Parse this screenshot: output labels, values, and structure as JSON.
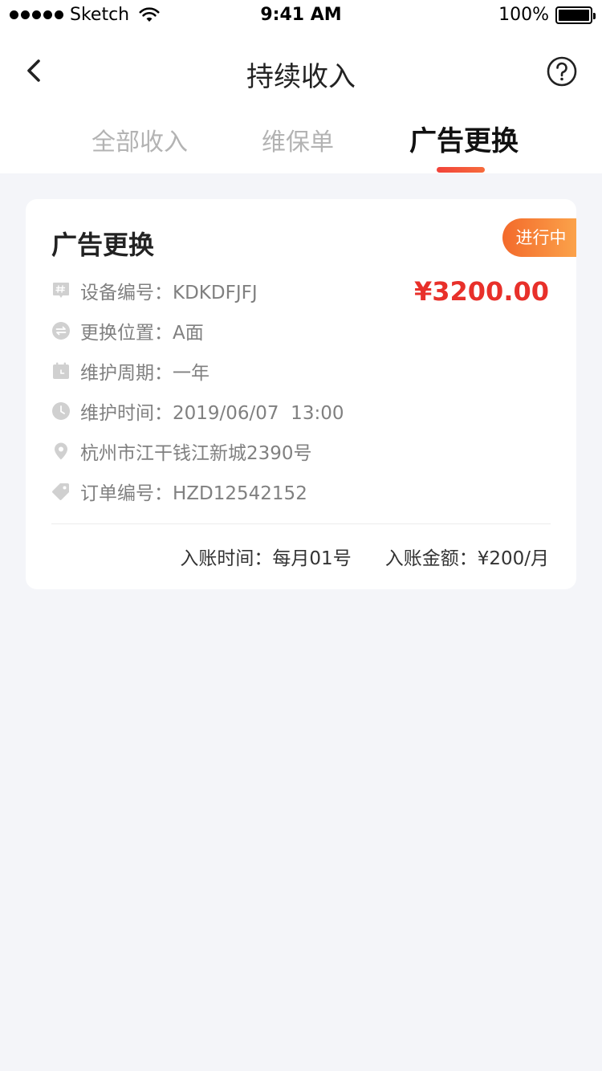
{
  "status_bar": {
    "carrier": "Sketch",
    "time": "9:41 AM",
    "battery": "100%"
  },
  "nav": {
    "title": "持续收入"
  },
  "tabs": [
    {
      "label": "全部收入",
      "active": false
    },
    {
      "label": "维保单",
      "active": false
    },
    {
      "label": "广告更换",
      "active": true
    }
  ],
  "card": {
    "title": "广告更换",
    "status_badge": "进行中",
    "price": "¥3200.00",
    "rows": [
      {
        "icon": "hash-tag-icon",
        "text": "设备编号：KDKDFJFJ"
      },
      {
        "icon": "swap-icon",
        "text": "更换位置：A面"
      },
      {
        "icon": "calendar-icon",
        "text": "维护周期：一年"
      },
      {
        "icon": "clock-icon",
        "text": "维护时间：2019/06/07  13:00"
      },
      {
        "icon": "location-pin-icon",
        "text": "杭州市江干钱江新城2390号"
      },
      {
        "icon": "price-tag-icon",
        "text": "订单编号：HZD12542152"
      }
    ],
    "footer": {
      "entry_time": "入账时间：每月01号",
      "entry_amount": "入账金额：¥200/月"
    }
  },
  "colors": {
    "accent_red": "#e8302a",
    "badge_gradient_start": "#f36a2b",
    "badge_gradient_end": "#fba24a",
    "page_background": "#f4f5f9",
    "icon_gray": "#d0d0d0"
  }
}
